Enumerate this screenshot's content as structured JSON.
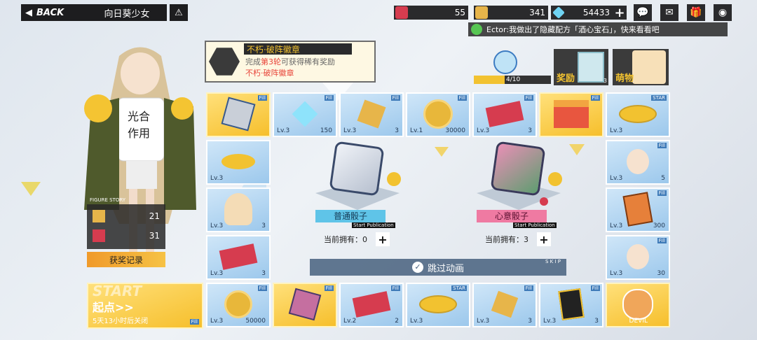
{
  "topbar": {
    "back_label": "BACK",
    "title": "向日葵少女",
    "help_icon": "warning-triangle-icon"
  },
  "resources": {
    "ticket_count": "55",
    "star_coin_count": "341",
    "diamond_count": "54433",
    "add_symbol": "+"
  },
  "top_icons": [
    "chat-bubble-icon",
    "mail-icon",
    "shop-bag-icon",
    "settings-eye-icon"
  ],
  "chat": {
    "text": "Ector:我做出了隐藏配方「酒心宝石」，快来看看吧"
  },
  "badge_event": {
    "title": "不朽·破阵徽章",
    "line1_prefix": "完成",
    "line1_highlight": "第3轮",
    "line1_suffix": "可获得稀有奖励",
    "line2": "不朽·破阵徽章"
  },
  "progress": {
    "text": "4/10",
    "fraction": 0.4
  },
  "reward": {
    "label": "奖励",
    "count": "3"
  },
  "mengwu": {
    "label": "萌物"
  },
  "stats": {
    "label": "FIGURE STORY",
    "row1": "21",
    "row2": "31"
  },
  "record_button": "获奖记录",
  "start": {
    "watermark": "START",
    "label": "起点>>",
    "sub": "5天13小时后关闭"
  },
  "dice": {
    "normal_label": "普通骰子",
    "normal_sub": "Start Publication",
    "normal_owned_label": "当前拥有：",
    "normal_owned": "0",
    "heart_label": "心意骰子",
    "heart_sub": "Start Publication",
    "heart_owned_label": "当前拥有：",
    "heart_owned": "3",
    "plus": "+"
  },
  "skip": {
    "label": "跳过动画",
    "sub": "S K I P"
  },
  "tiles": {
    "t1": {
      "lv": "",
      "cnt": ""
    },
    "t2": {
      "lv": "Lv.3",
      "cnt": "150"
    },
    "t3": {
      "lv": "Lv.3",
      "cnt": "3"
    },
    "t4": {
      "lv": "Lv.1",
      "cnt": "30000"
    },
    "t5": {
      "lv": "Lv.3",
      "cnt": "3"
    },
    "t6": {
      "lv": "",
      "cnt": ""
    },
    "t7": {
      "lv": "Lv.3",
      "cnt": ""
    },
    "r1": {
      "lv": "Lv.3",
      "cnt": "5"
    },
    "r2": {
      "lv": "Lv.3",
      "cnt": "300"
    },
    "r3": {
      "lv": "Lv.3",
      "cnt": "30"
    },
    "l1": {
      "lv": "Lv.3",
      "cnt": ""
    },
    "l2": {
      "lv": "Lv.3",
      "cnt": "3"
    },
    "l3": {
      "lv": "Lv.3",
      "cnt": "3"
    },
    "b1": {
      "lv": "Lv.3",
      "cnt": "50000"
    },
    "b2": {
      "lv": "",
      "cnt": ""
    },
    "b3": {
      "lv": "Lv.2",
      "cnt": "2"
    },
    "b4": {
      "lv": "Lv.3",
      "cnt": ""
    },
    "b5": {
      "lv": "Lv.3",
      "cnt": "3"
    },
    "b6": {
      "lv": "Lv.3",
      "cnt": "3"
    },
    "b7": {
      "lv": "DEVIL",
      "cnt": ""
    },
    "badge_text": "Fill",
    "star_text": "STAR"
  },
  "colors": {
    "tile_blue": "#9cc8ec",
    "tile_gold": "#f6bf2c",
    "highlight_red": "#e8463b",
    "bar_dark": "#1d1d1f",
    "normal_dice_label_bg": "#5fc4e8",
    "heart_dice_label_bg": "#ef7aa2"
  }
}
